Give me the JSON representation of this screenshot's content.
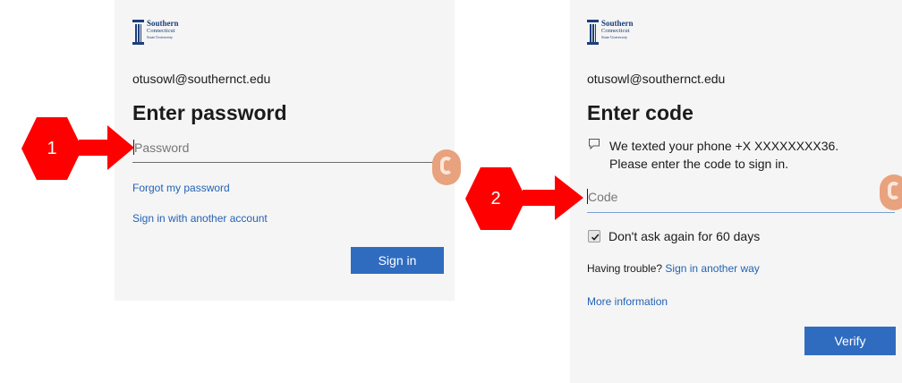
{
  "logo": {
    "line1": "Southern",
    "line2": "Connecticut",
    "line3": "State University"
  },
  "screen1": {
    "email": "otusowl@southernct.edu",
    "title": "Enter password",
    "password_placeholder": "Password",
    "forgot_link": "Forgot my password",
    "other_account_link": "Sign in with another account",
    "signin_button": "Sign in"
  },
  "screen2": {
    "email": "otusowl@southernct.edu",
    "title": "Enter code",
    "message_line1": "We texted your phone +X XXXXXXXX36.",
    "message_line2": "Please enter the code to sign in.",
    "code_placeholder": "Code",
    "dont_ask_label": "Don't ask again for 60 days",
    "dont_ask_checked": true,
    "trouble_text": "Having trouble?",
    "other_way_link": "Sign in another way",
    "more_info_link": "More information",
    "verify_button": "Verify"
  },
  "callouts": [
    {
      "number": "1"
    },
    {
      "number": "2"
    }
  ],
  "colors": {
    "accent_blue": "#2f6cc0",
    "link_blue": "#2363b5",
    "callout_red": "#ff0000"
  },
  "icons": [
    "chat-bubble-icon",
    "checkmark-icon",
    "arrow-right-icon"
  ]
}
